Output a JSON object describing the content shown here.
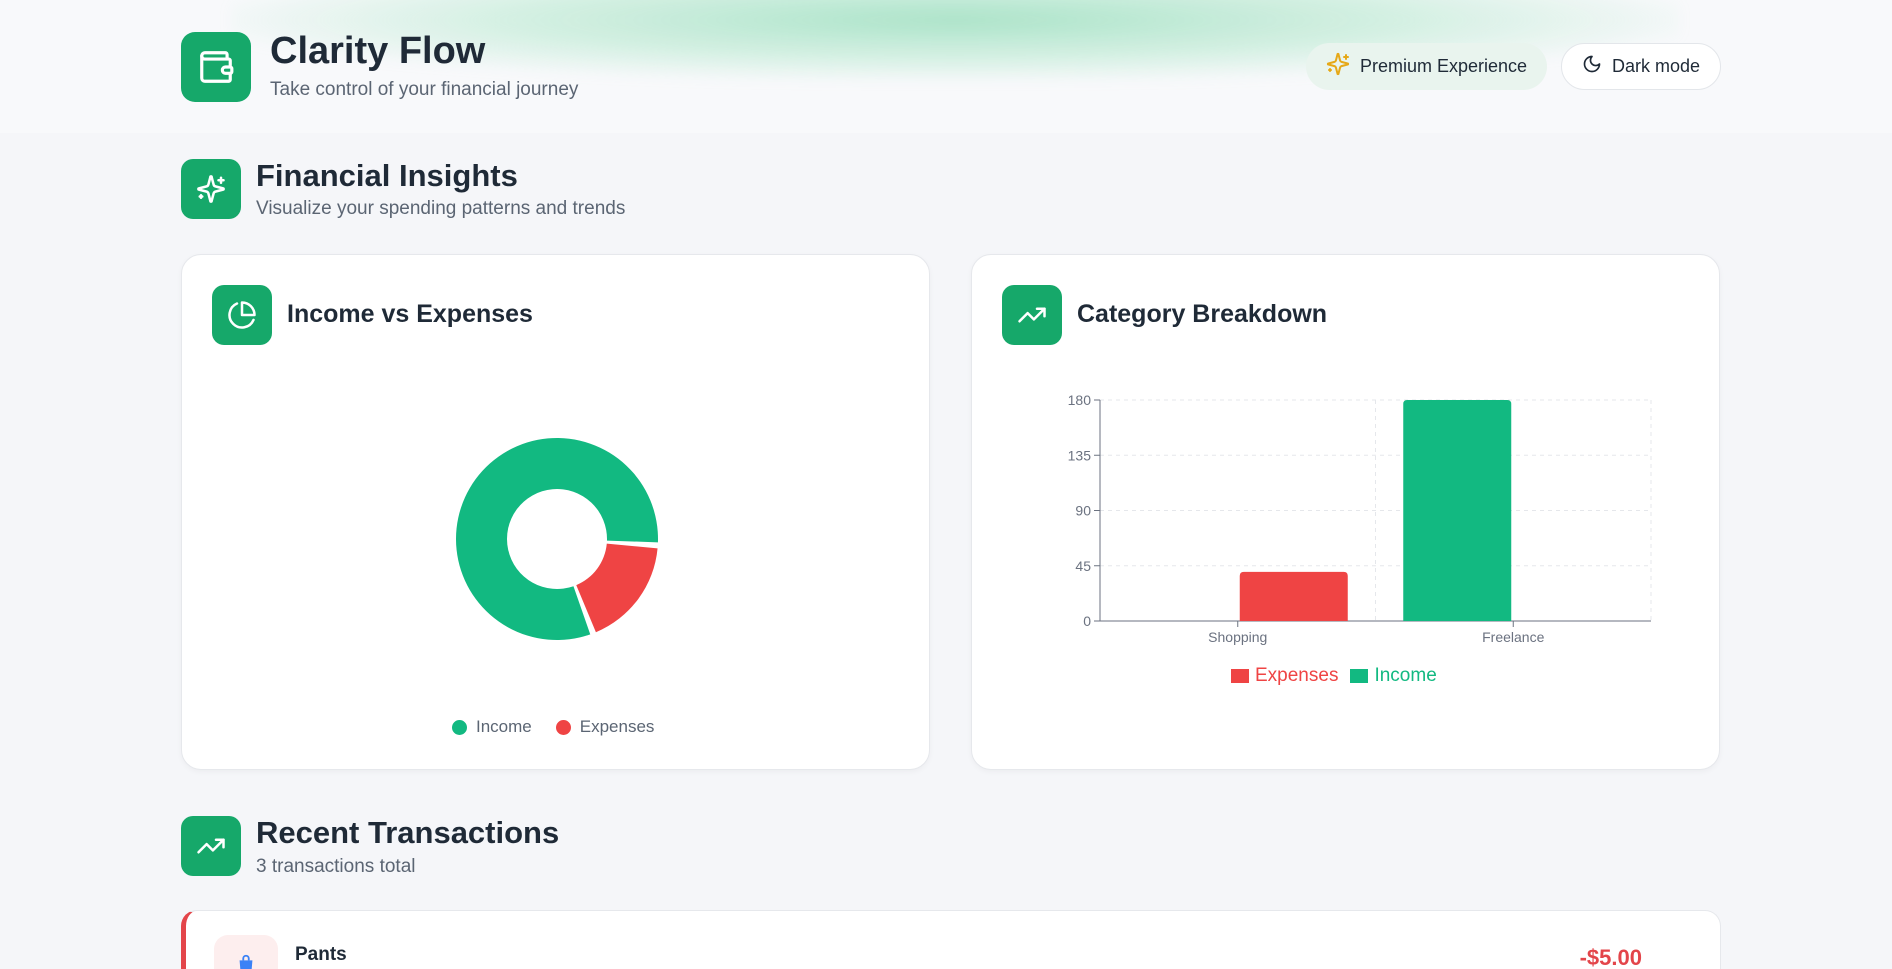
{
  "header": {
    "title": "Clarity Flow",
    "subtitle": "Take control of your financial journey",
    "premium_label": "Premium Experience",
    "dark_mode_label": "Dark mode"
  },
  "insights": {
    "title": "Financial Insights",
    "subtitle": "Visualize your spending patterns and trends"
  },
  "donut_card": {
    "title": "Income vs Expenses",
    "legend": [
      "Income",
      "Expenses"
    ]
  },
  "bar_card": {
    "title": "Category Breakdown"
  },
  "transactions": {
    "title": "Recent Transactions",
    "subtitle": "3 transactions total",
    "items": [
      {
        "name": "Pants",
        "amount": "-$5.00",
        "type": "expense"
      }
    ]
  },
  "colors": {
    "accent": "#16a86a",
    "income": "#12b981",
    "expense": "#ef4444"
  },
  "chart_data": [
    {
      "type": "pie",
      "title": "Income vs Expenses",
      "categories": [
        "Income",
        "Expenses"
      ],
      "values": [
        180,
        40
      ],
      "donut": true
    },
    {
      "type": "bar",
      "title": "Category Breakdown",
      "categories": [
        "Shopping",
        "Freelance"
      ],
      "series": [
        {
          "name": "Expenses",
          "values": [
            40,
            0
          ]
        },
        {
          "name": "Income",
          "values": [
            0,
            180
          ]
        }
      ],
      "yticks": [
        "0",
        "45",
        "90",
        "135",
        "180"
      ],
      "ylim": [
        0,
        180
      ],
      "grid": true,
      "legend": "bottom"
    }
  ]
}
